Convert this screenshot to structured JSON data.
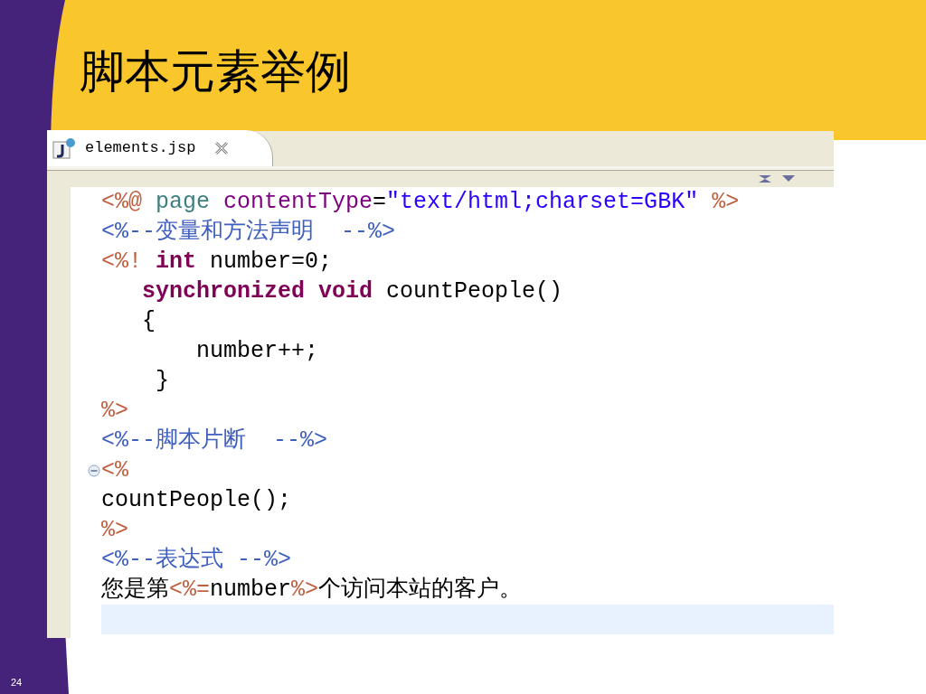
{
  "slide": {
    "title": "脚本元素举例",
    "page_number": "24"
  },
  "editor": {
    "tabs": [
      {
        "label": "elements.jsp",
        "selected": true
      }
    ],
    "lines": [
      {
        "current": false,
        "foldable": false,
        "tokens": [
          {
            "kind": "tag",
            "text": "<%@"
          },
          {
            "kind": "directive",
            "text": " page"
          },
          {
            "kind": "attribute",
            "text": " contentType"
          },
          {
            "kind": "plain",
            "text": "="
          },
          {
            "kind": "string",
            "text": "\"text/html;charset=GBK\""
          },
          {
            "kind": "tag",
            "text": " %>"
          }
        ]
      },
      {
        "current": false,
        "foldable": false,
        "tokens": [
          {
            "kind": "comment",
            "text": "<%--变量和方法声明  --%>"
          }
        ]
      },
      {
        "current": false,
        "foldable": false,
        "tokens": [
          {
            "kind": "tag",
            "text": "<%!"
          },
          {
            "kind": "keyword",
            "text": " int"
          },
          {
            "kind": "plain",
            "text": " number=0;"
          }
        ]
      },
      {
        "current": false,
        "foldable": false,
        "tokens": [
          {
            "kind": "keyword",
            "text": "   synchronized"
          },
          {
            "kind": "keyword",
            "text": " void"
          },
          {
            "kind": "plain",
            "text": " countPeople()"
          }
        ]
      },
      {
        "current": false,
        "foldable": false,
        "tokens": [
          {
            "kind": "plain",
            "text": "   {"
          }
        ]
      },
      {
        "current": false,
        "foldable": false,
        "tokens": [
          {
            "kind": "plain",
            "text": "       number++;"
          }
        ]
      },
      {
        "current": false,
        "foldable": false,
        "tokens": [
          {
            "kind": "plain",
            "text": "    }"
          }
        ]
      },
      {
        "current": false,
        "foldable": false,
        "tokens": [
          {
            "kind": "tag",
            "text": "%>"
          }
        ]
      },
      {
        "current": false,
        "foldable": false,
        "tokens": [
          {
            "kind": "comment",
            "text": "<%--脚本片断  --%>"
          }
        ]
      },
      {
        "current": false,
        "foldable": true,
        "tokens": [
          {
            "kind": "tag",
            "text": "<%"
          }
        ]
      },
      {
        "current": false,
        "foldable": false,
        "tokens": [
          {
            "kind": "plain",
            "text": "countPeople();"
          }
        ]
      },
      {
        "current": false,
        "foldable": false,
        "tokens": [
          {
            "kind": "tag",
            "text": "%>"
          }
        ]
      },
      {
        "current": false,
        "foldable": false,
        "tokens": [
          {
            "kind": "comment",
            "text": "<%--表达式 --%>"
          }
        ]
      },
      {
        "current": false,
        "foldable": false,
        "tokens": [
          {
            "kind": "plain",
            "text": "您是第"
          },
          {
            "kind": "tag",
            "text": "<%="
          },
          {
            "kind": "plain",
            "text": "number"
          },
          {
            "kind": "tag",
            "text": "%>"
          },
          {
            "kind": "plain",
            "text": "个访问本站的客户。"
          }
        ]
      },
      {
        "current": true,
        "foldable": false
      }
    ]
  }
}
